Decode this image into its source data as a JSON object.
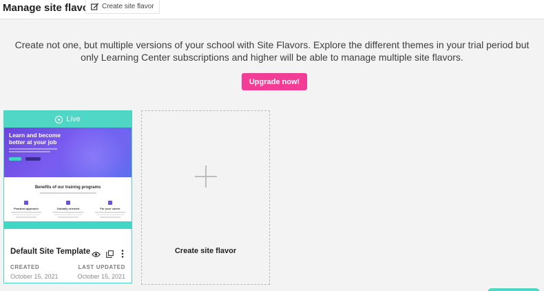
{
  "header": {
    "title": "Manage site flavors",
    "create_button_label": "Create site flavor"
  },
  "intro_text": "Create not one, but multiple versions of your school with Site Flavors. Explore the different themes in your trial period but only Learning Center subscriptions and higher will be able to manage multiple site flavors.",
  "upgrade_button_label": "Upgrade now!",
  "flavors": [
    {
      "status": "Live",
      "name": "Default Site Template",
      "preview": {
        "hero_title": "Learn and become better at your job",
        "benefits_title": "Benefits of our training programs",
        "features": [
          "Practical approach",
          "Globally oriented",
          "For your career"
        ]
      },
      "created_label": "CREATED",
      "created_date": "October 15, 2021",
      "updated_label": "LAST UPDATED",
      "updated_date": "October 15, 2021"
    }
  ],
  "new_flavor_card_label": "Create site flavor",
  "colors": {
    "accent_pink": "#f23c95",
    "teal": "#4fd6c4",
    "hero_purple": "#6a45d9"
  },
  "icons": {
    "create": "edit-square-icon",
    "live": "live-pin-icon",
    "preview": "eye-icon",
    "duplicate": "copy-icon",
    "more": "kebab-menu-icon",
    "add": "plus-icon"
  }
}
